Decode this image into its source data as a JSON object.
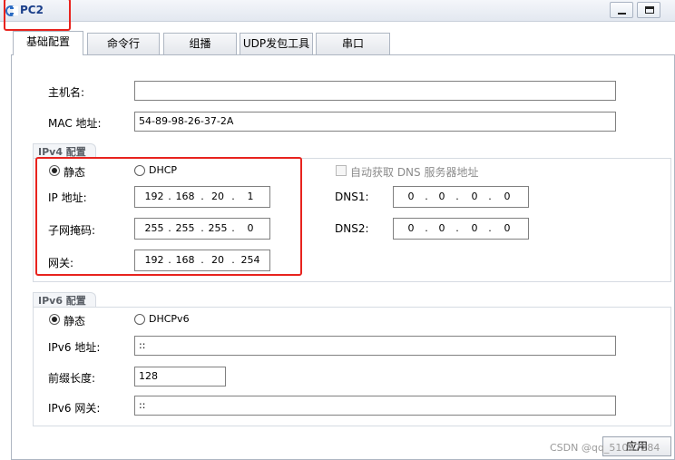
{
  "window": {
    "title": "PC2"
  },
  "tabs": [
    {
      "label": "基础配置",
      "active": true
    },
    {
      "label": "命令行",
      "active": false
    },
    {
      "label": "组播",
      "active": false
    },
    {
      "label": "UDP发包工具",
      "active": false
    },
    {
      "label": "串口",
      "active": false
    }
  ],
  "basic": {
    "hostname_label": "主机名:",
    "hostname_value": "",
    "mac_label": "MAC 地址:",
    "mac_value": "54-89-98-26-37-2A"
  },
  "ipv4": {
    "group_title": "IPv4 配置",
    "static_label": "静态",
    "dhcp_label": "DHCP",
    "mode": "static",
    "auto_dns_label": "自动获取 DNS 服务器地址",
    "auto_dns_checked": false,
    "ip_label": "IP 地址:",
    "ip": [
      "192",
      "168",
      "20",
      "1"
    ],
    "mask_label": "子网掩码:",
    "mask": [
      "255",
      "255",
      "255",
      "0"
    ],
    "gateway_label": "网关:",
    "gateway": [
      "192",
      "168",
      "20",
      "254"
    ],
    "dns1_label": "DNS1:",
    "dns1": [
      "0",
      "0",
      "0",
      "0"
    ],
    "dns2_label": "DNS2:",
    "dns2": [
      "0",
      "0",
      "0",
      "0"
    ]
  },
  "ipv6": {
    "group_title": "IPv6 配置",
    "static_label": "静态",
    "dhcp_label": "DHCPv6",
    "mode": "static",
    "address_label": "IPv6 地址:",
    "address_value": "::",
    "prefix_label": "前缀长度:",
    "prefix_value": "128",
    "gateway_label": "IPv6 网关:",
    "gateway_value": "::"
  },
  "footer": {
    "apply_label": "应用",
    "watermark": "CSDN @qq_51097284"
  },
  "colors": {
    "highlight": "#e8231e",
    "title_text": "#1b3f8a"
  }
}
